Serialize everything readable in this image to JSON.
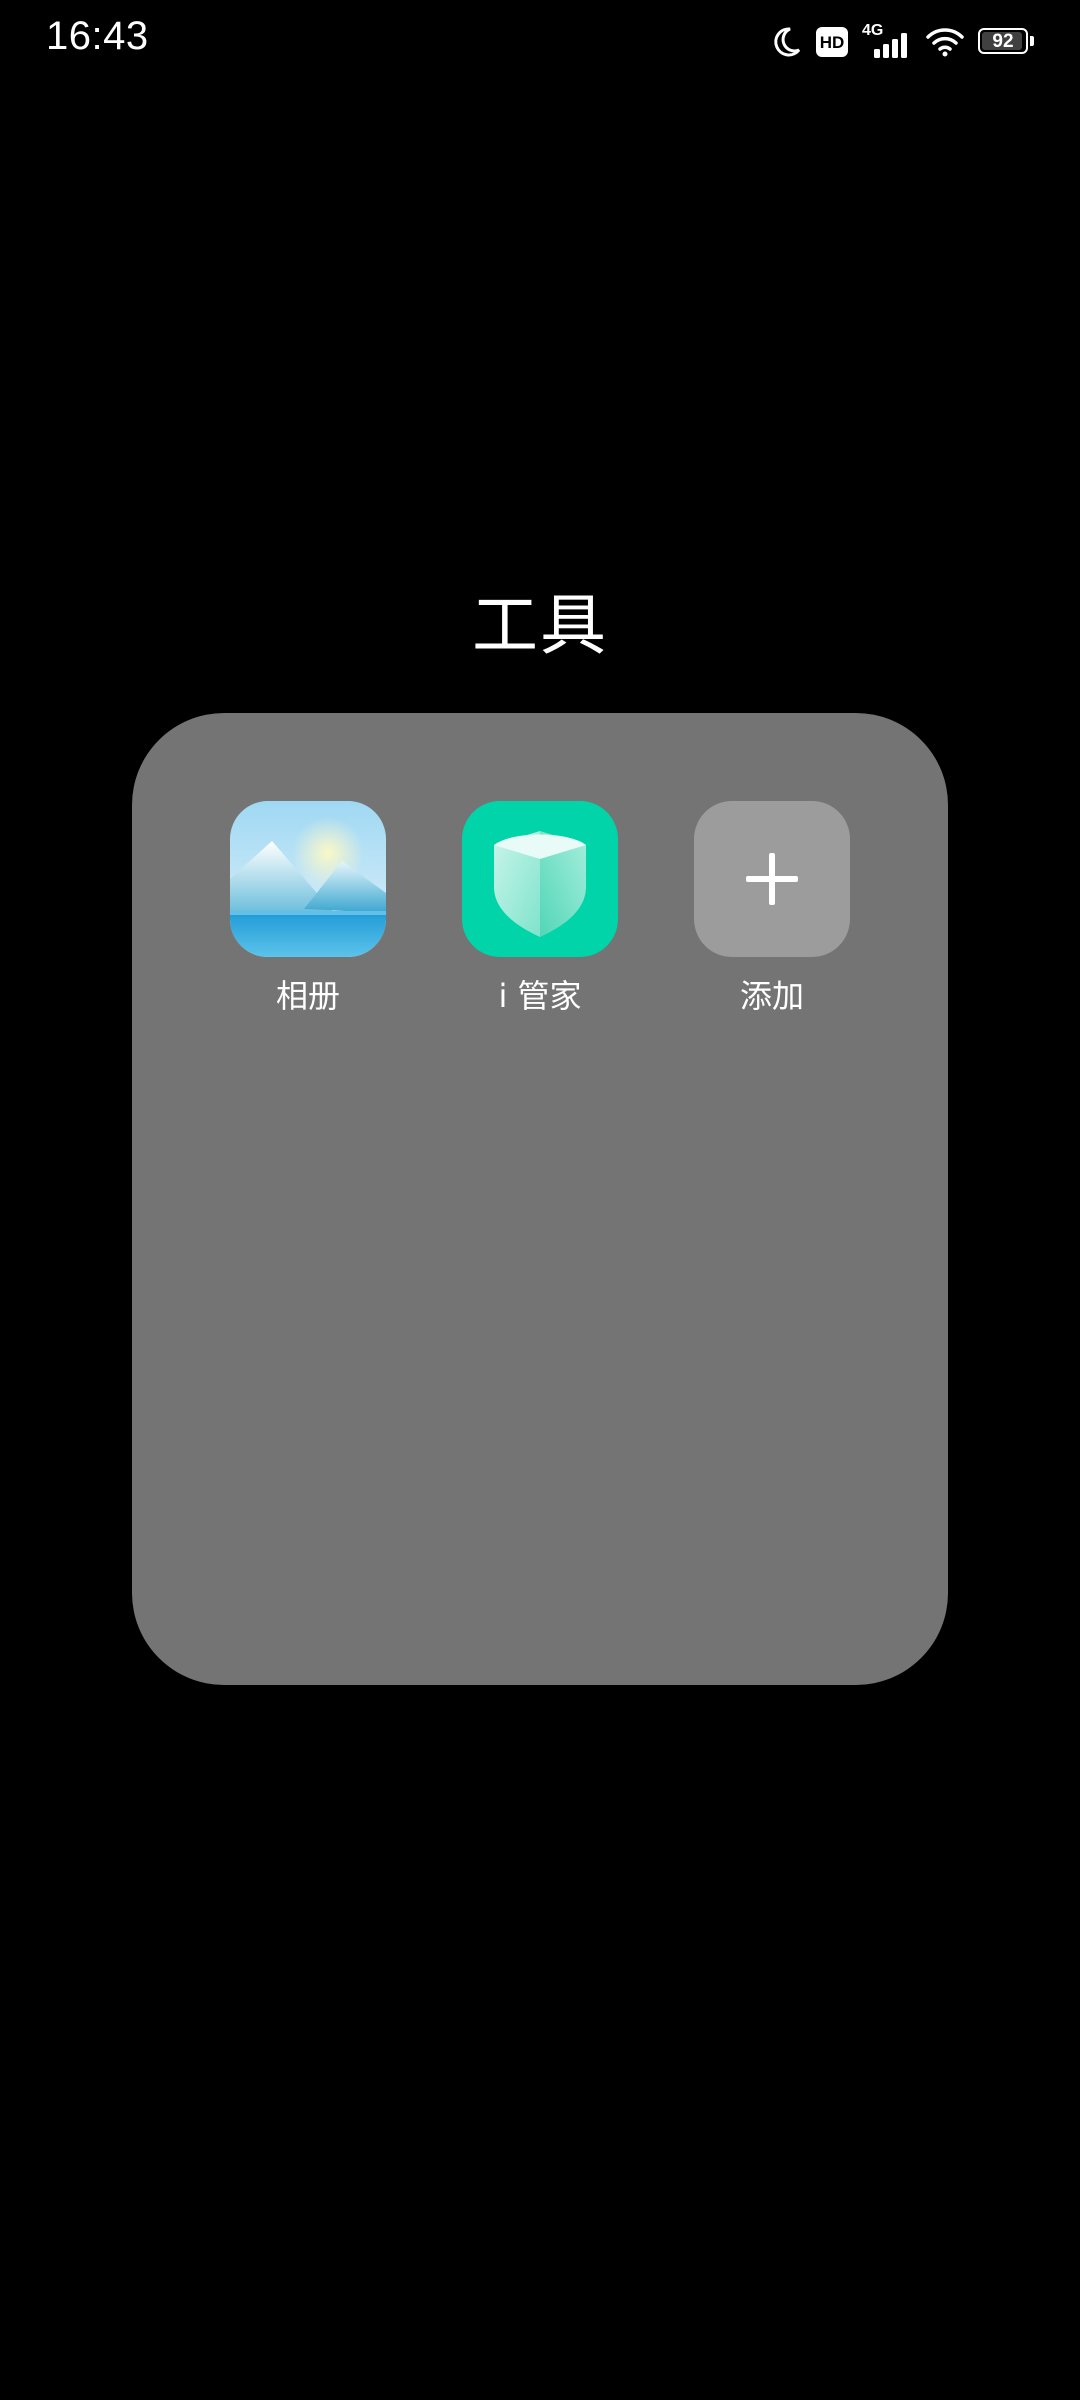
{
  "status_bar": {
    "time": "16:43",
    "icons": [
      "moon-icon",
      "hd-icon",
      "4g-signal-icon",
      "wifi-icon",
      "battery-icon"
    ],
    "network_label": "4G",
    "hd_label": "HD",
    "battery_level": "92"
  },
  "folder": {
    "title": "工具",
    "apps": [
      {
        "label": "相册",
        "icon": "gallery-icon"
      },
      {
        "label": "i 管家",
        "icon": "shield-icon",
        "color": "#00D4A8"
      },
      {
        "label": "添加",
        "icon": "plus-icon",
        "color": "#9C9C9C"
      }
    ]
  },
  "colors": {
    "background": "#000000",
    "folder_panel": "#747474",
    "text": "#FFFFFF"
  }
}
